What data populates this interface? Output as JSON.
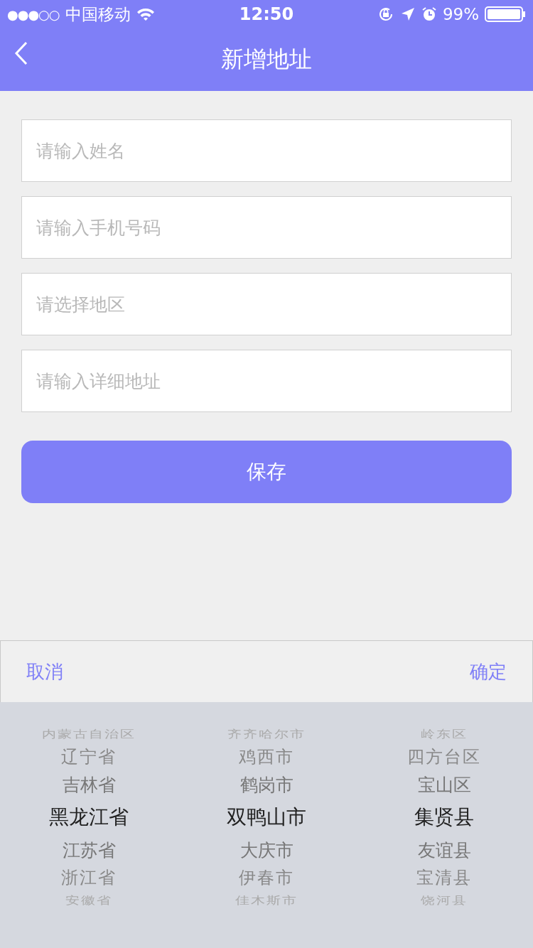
{
  "status_bar": {
    "signal_dots": "●●●○○",
    "carrier": "中国移动",
    "time": "12:50",
    "battery": "99%"
  },
  "nav": {
    "title": "新增地址"
  },
  "fields": [
    {
      "placeholder": "请输入姓名"
    },
    {
      "placeholder": "请输入手机号码"
    },
    {
      "placeholder": "请选择地区"
    },
    {
      "placeholder": "请输入详细地址"
    }
  ],
  "save_button": "保存",
  "picker": {
    "cancel": "取消",
    "confirm": "确定",
    "columns": [
      {
        "items": [
          {
            "label": "内蒙古自治区",
            "selected": false
          },
          {
            "label": "辽宁省",
            "selected": false
          },
          {
            "label": "吉林省",
            "selected": false
          },
          {
            "label": "黑龙江省",
            "selected": true
          },
          {
            "label": "江苏省",
            "selected": false
          },
          {
            "label": "浙江省",
            "selected": false
          },
          {
            "label": "安徽省",
            "selected": false
          }
        ]
      },
      {
        "items": [
          {
            "label": "齐齐哈尔市",
            "selected": false
          },
          {
            "label": "鸡西市",
            "selected": false
          },
          {
            "label": "鹤岗市",
            "selected": false
          },
          {
            "label": "双鸭山市",
            "selected": true
          },
          {
            "label": "大庆市",
            "selected": false
          },
          {
            "label": "伊春市",
            "selected": false
          },
          {
            "label": "佳木斯市",
            "selected": false
          }
        ]
      },
      {
        "items": [
          {
            "label": "岭东区",
            "selected": false
          },
          {
            "label": "四方台区",
            "selected": false
          },
          {
            "label": "宝山区",
            "selected": false
          },
          {
            "label": "集贤县",
            "selected": true
          },
          {
            "label": "友谊县",
            "selected": false
          },
          {
            "label": "宝清县",
            "selected": false
          },
          {
            "label": "饶河县",
            "selected": false
          }
        ]
      }
    ]
  }
}
